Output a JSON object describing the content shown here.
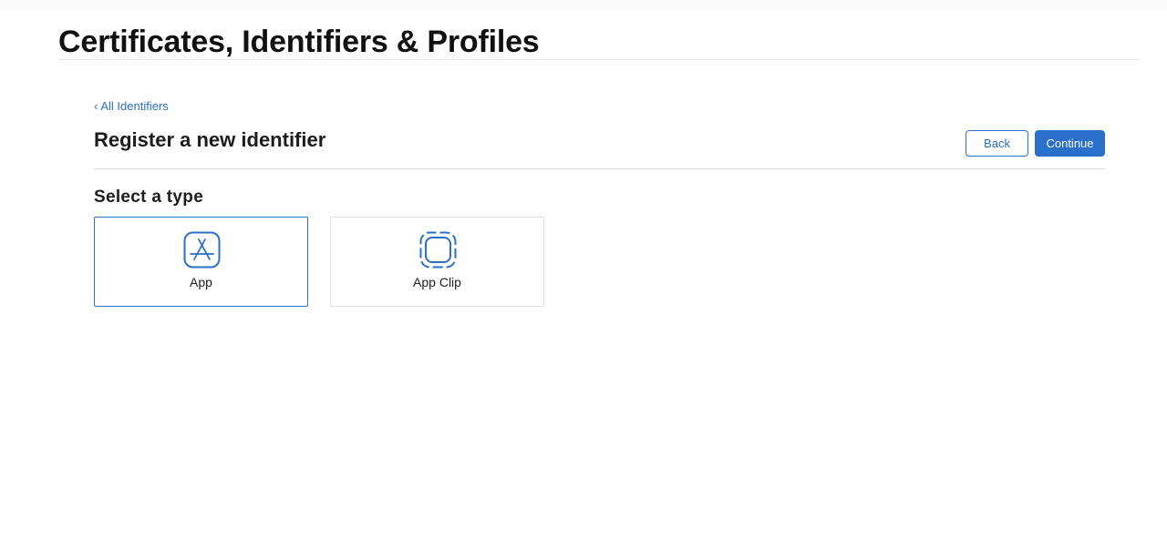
{
  "header": {
    "title": "Certificates, Identifiers & Profiles"
  },
  "breadcrumb": {
    "chevron": "‹",
    "label": "All Identifiers"
  },
  "page": {
    "title": "Register a new identifier",
    "back_label": "Back",
    "continue_label": "Continue",
    "section_title": "Select a type"
  },
  "types": [
    {
      "label": "App",
      "icon": "app-store-icon",
      "selected": true
    },
    {
      "label": "App Clip",
      "icon": "app-clip-icon",
      "selected": false
    }
  ],
  "colors": {
    "accent": "#2a6fc9",
    "text": "#1d1d1f",
    "divider": "#d9d9d9"
  }
}
